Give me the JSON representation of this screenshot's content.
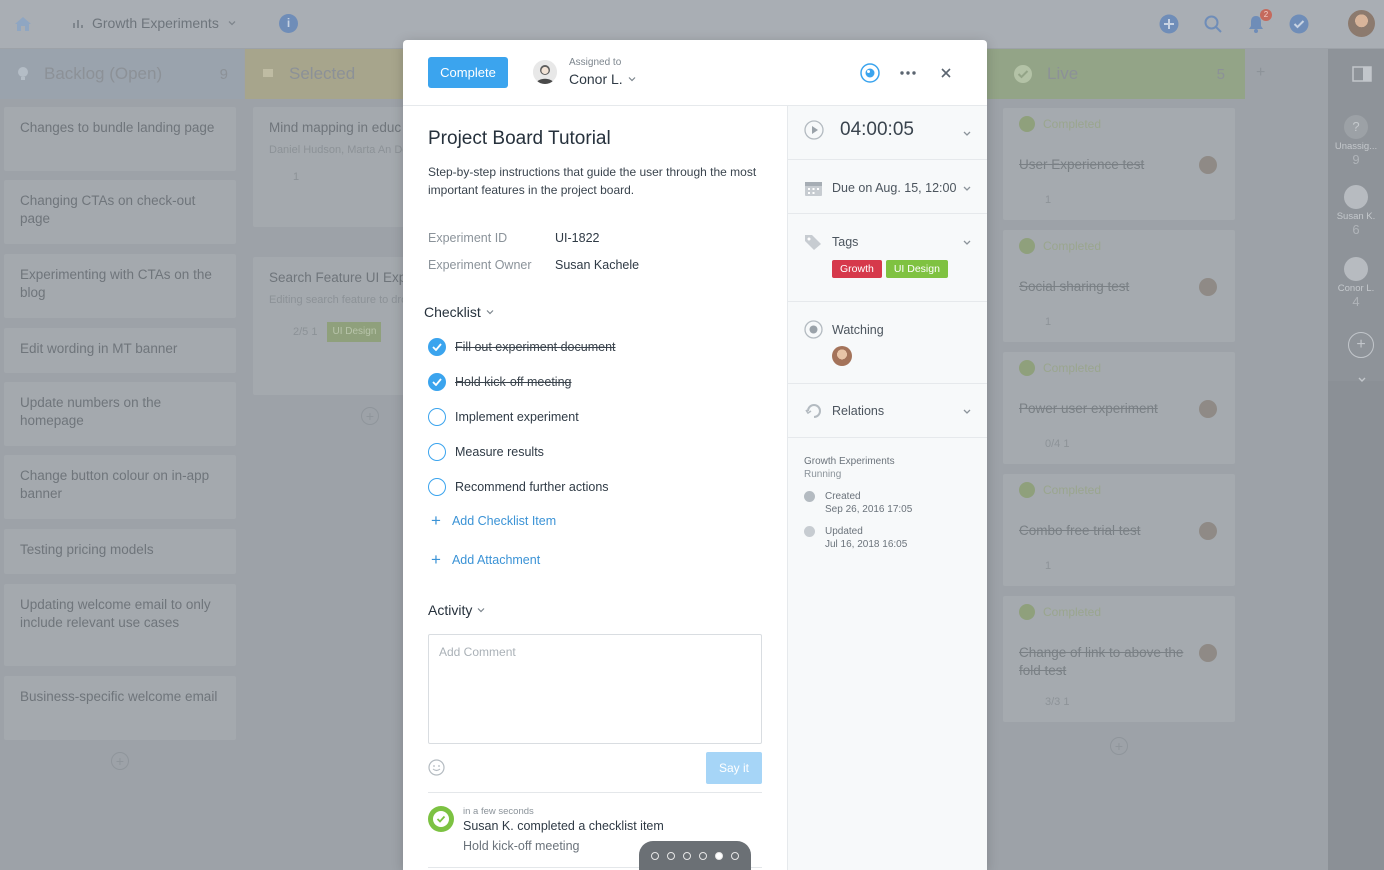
{
  "app": {
    "project_name": "Growth Experiments",
    "notification_count": "2"
  },
  "board": {
    "columns": [
      {
        "name": "Backlog (Open)",
        "count": "9"
      },
      {
        "name": "Selected",
        "count": ""
      },
      {
        "name": "Live",
        "count": "5"
      }
    ],
    "backlog_cards": [
      "Changes to bundle landing page",
      "Changing CTAs on check-out page",
      "Experimenting with CTAs on the blog",
      "Edit wording in MT banner",
      "Update numbers on the homepage",
      "Change button colour on in-app banner",
      "Testing pricing models",
      "Updating welcome email to only include relevant use cases",
      "Business-specific welcome email"
    ],
    "selected_cards": [
      {
        "title": "Mind mapping in educ video",
        "people": "Daniel Hudson, Marta An Doris Jones",
        "meta": "1"
      },
      {
        "title": "Search Feature UI Experiment",
        "people": "Editing search feature to drop-off",
        "meta": "2/5   1",
        "tag": "UI Design"
      }
    ],
    "live_cards": [
      {
        "status": "Completed",
        "title": "User Experience test",
        "meta": "1"
      },
      {
        "status": "Completed",
        "title": "Social sharing test",
        "meta": "1"
      },
      {
        "status": "Completed",
        "title": "Power user experiment",
        "meta": "0/4   1"
      },
      {
        "status": "Completed",
        "title": "Combo free trial test",
        "meta": "1"
      },
      {
        "status": "Completed",
        "title": "Change of link to above the fold test",
        "meta": "3/3   1"
      }
    ],
    "rail": [
      {
        "label": "Unassig...",
        "count": "9"
      },
      {
        "label": "Susan K.",
        "count": "6"
      },
      {
        "label": "Conor L.",
        "count": "4"
      }
    ]
  },
  "modal": {
    "complete_label": "Complete",
    "assigned_label": "Assigned to",
    "assignee": "Conor L.",
    "title": "Project Board Tutorial",
    "description": "Step-by-step instructions that guide the user through the most important features in the project board.",
    "fields": [
      {
        "label": "Experiment ID",
        "value": "UI-1822"
      },
      {
        "label": "Experiment Owner",
        "value": "Susan Kachele"
      }
    ],
    "checklist_label": "Checklist",
    "checklist": [
      {
        "text": "Fill out experiment document",
        "done": true
      },
      {
        "text": "Hold kick-off meeting",
        "done": true
      },
      {
        "text": "Implement experiment",
        "done": false
      },
      {
        "text": "Measure results",
        "done": false
      },
      {
        "text": "Recommend further actions",
        "done": false
      }
    ],
    "add_checklist_label": "Add Checklist Item",
    "add_attachment_label": "Add Attachment",
    "activity_label": "Activity",
    "comment_placeholder": "Add Comment",
    "say_it_label": "Say it",
    "activity": {
      "time": "in a few seconds",
      "text": "Susan K. completed a checklist item",
      "item": "Hold kick-off meeting"
    }
  },
  "sidebar": {
    "timer": "04:00:05",
    "due": "Due on Aug. 15, 12:00",
    "tags_label": "Tags",
    "tags": [
      {
        "name": "Growth",
        "color": "#d6394b"
      },
      {
        "name": "UI Design",
        "color": "#7fc241"
      }
    ],
    "watching_label": "Watching",
    "relations_label": "Relations",
    "project": "Growth Experiments",
    "project_status": "Running",
    "created_label": "Created",
    "created_date": "Sep 26, 2016 17:05",
    "updated_label": "Updated",
    "updated_date": "Jul 16, 2018 16:05"
  },
  "pager": {
    "count": 6,
    "active_index": 4
  },
  "colors": {
    "accent": "#3ba4ee",
    "success": "#7cc242",
    "tag_growth": "#d6394b",
    "tag_ui": "#7fc241"
  }
}
